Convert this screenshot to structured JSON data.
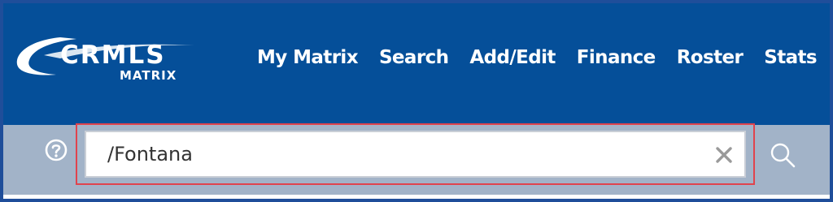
{
  "logo": {
    "name": "CRMLS",
    "sub": "MATRIX"
  },
  "nav": {
    "items": [
      {
        "label": "My Matrix"
      },
      {
        "label": "Search"
      },
      {
        "label": "Add/Edit"
      },
      {
        "label": "Finance"
      },
      {
        "label": "Roster"
      },
      {
        "label": "Stats"
      }
    ]
  },
  "search": {
    "value": "/Fontana",
    "help_icon": "question-circle",
    "clear_icon": "close-x",
    "search_icon": "magnifier"
  },
  "colors": {
    "header_bg": "#054f99",
    "searchbar_bg": "#a2b3c8",
    "highlight": "#e0434d"
  }
}
